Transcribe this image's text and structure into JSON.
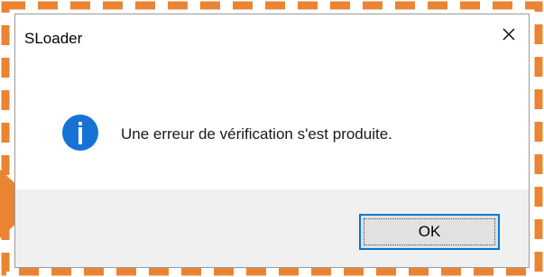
{
  "dialog": {
    "title": "SLoader",
    "message": "Une erreur de vérification s'est produite.",
    "ok_label": "OK",
    "icon": "info-icon",
    "close_icon": "close-icon"
  },
  "annotation": {
    "border_color": "#ea8433",
    "arrow_color": "#ea8433",
    "border_style": "dashed"
  },
  "colors": {
    "info_icon": "#1672d4",
    "footer": "#f0f0f0",
    "button_border": "#0078d7"
  }
}
